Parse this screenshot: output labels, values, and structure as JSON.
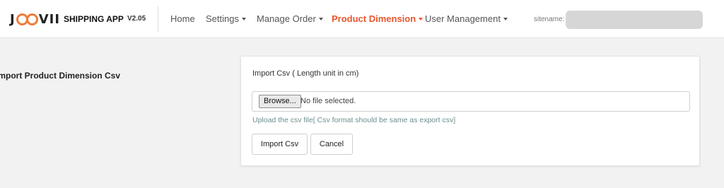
{
  "header": {
    "app_name": "SHIPPING APP",
    "version": "V2.05",
    "sitename_label": "sitename:",
    "sitename_value": ""
  },
  "nav": {
    "home": "Home",
    "settings": "Settings",
    "manage_order": "Manage Order",
    "product_dimension": "Product Dimension",
    "user_management": "User Management"
  },
  "colors": {
    "accent": "#e8552b",
    "logo_ring": "#f07c3b",
    "help_text": "#6b8e8e"
  },
  "page": {
    "section_title": "Import Product Dimension Csv"
  },
  "form": {
    "label": "Import Csv ( Length unit in cm)",
    "browse_label": "Browse...",
    "file_status": "No file selected.",
    "help_text": "Upload the csv file[ Csv format should be same as export csv]",
    "import_label": "Import Csv",
    "cancel_label": "Cancel"
  }
}
